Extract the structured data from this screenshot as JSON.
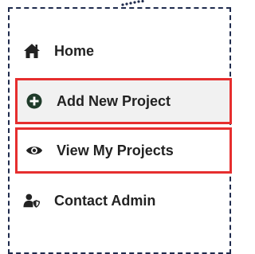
{
  "sidebar": {
    "items": [
      {
        "label": "Home",
        "icon": "home-icon"
      },
      {
        "label": "Add New Project",
        "icon": "plus-circle-icon"
      },
      {
        "label": "View My Projects",
        "icon": "eye-icon"
      },
      {
        "label": "Contact Admin",
        "icon": "user-shield-icon"
      }
    ]
  },
  "colors": {
    "text": "#222222",
    "highlight_border": "#e62e2e",
    "frame_border": "#1f2b4d",
    "active_bg": "#f1f1f1"
  }
}
